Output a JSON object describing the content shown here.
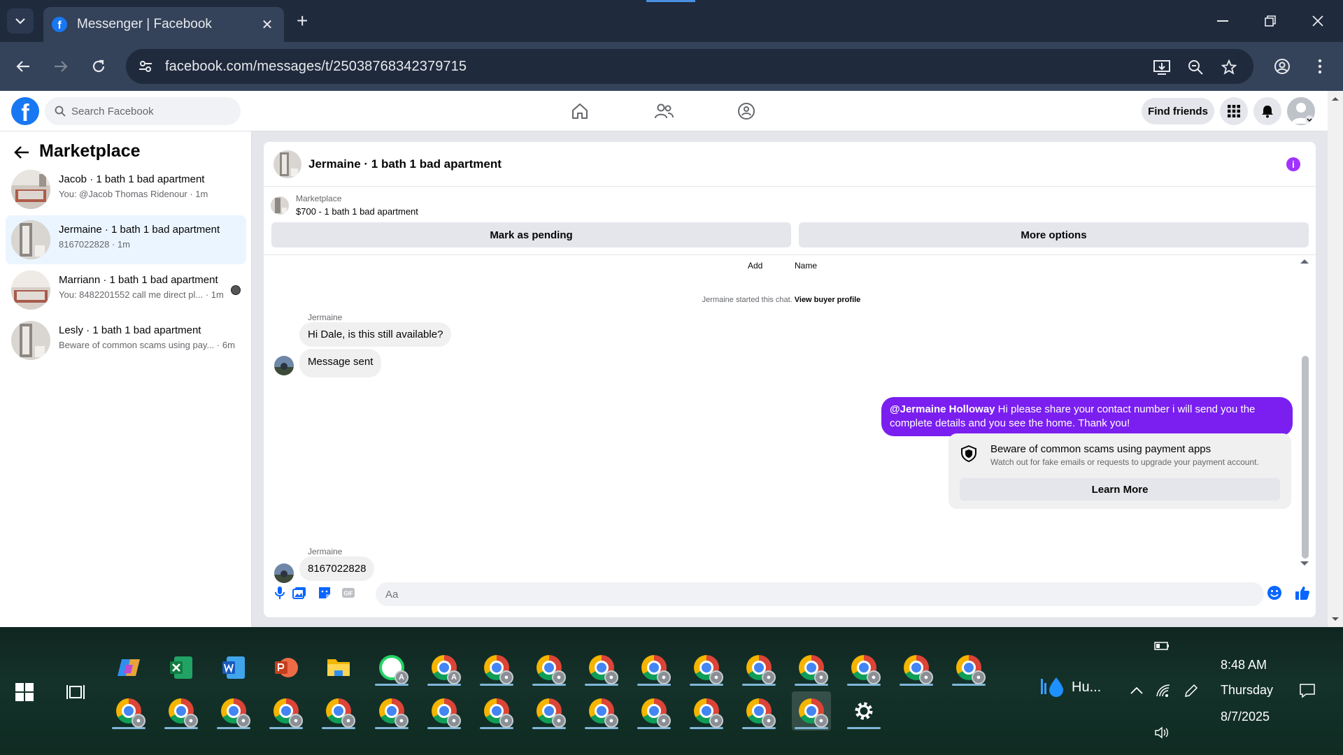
{
  "browser": {
    "tab_title": "Messenger | Facebook",
    "tab_close": "✕",
    "new_tab": "+",
    "url": "facebook.com/messages/t/25038768342379715",
    "window_controls": [
      "minimize",
      "restore",
      "close"
    ]
  },
  "fb_nav": {
    "logo": "f",
    "search_placeholder": "Search Facebook",
    "find_friends": "Find friends"
  },
  "sidebar": {
    "heading": "Marketplace",
    "conversations": [
      {
        "title": "Jacob · 1 bath 1 bad apartment",
        "subtitle": "You: @Jacob Thomas Ridenour · 1m",
        "active": false
      },
      {
        "title": "Jermaine · 1 bath 1 bad apartment",
        "subtitle": "8167022828 · 1m",
        "active": true
      },
      {
        "title": "Marriann · 1 bath 1 bad apartment",
        "subtitle": "You: 8482201552 call me direct pl... · 1m",
        "active": false
      },
      {
        "title": "Lesly · 1 bath 1 bad apartment",
        "subtitle": "Beware of common scams using pay... · 6m",
        "active": false
      }
    ]
  },
  "chat": {
    "title": "Jermaine · 1 bath 1 bad apartment",
    "listing": {
      "source": "Marketplace",
      "description": "$700 - 1 bath 1 bad apartment",
      "mark_pending": "Mark as pending",
      "more_options": "More options"
    },
    "top_labels": {
      "add": "Add",
      "name": "Name"
    },
    "started_text": "Jermaine started this chat.",
    "view_buyer_profile": "View buyer profile",
    "sender_1": "Jermaine",
    "msg_1": "Hi Dale, is this still available?",
    "msg_2": "Message sent",
    "outgoing_mention": "@Jermaine Holloway",
    "outgoing_text": " Hi please share your contact number i will send you the complete details and you see the home. Thank you!",
    "scam_title": "Beware of common scams using payment apps",
    "scam_subtitle": "Watch out for fake emails or requests to upgrade your payment account.",
    "learn_more": "Learn More",
    "sender_2": "Jermaine",
    "msg_3": "8167022828",
    "composer_placeholder": "Aa"
  },
  "taskbar": {
    "weather": "Hu...",
    "time": "8:48 AM",
    "day": "Thursday",
    "date": "8/7/2025",
    "profile_badge": "A"
  }
}
